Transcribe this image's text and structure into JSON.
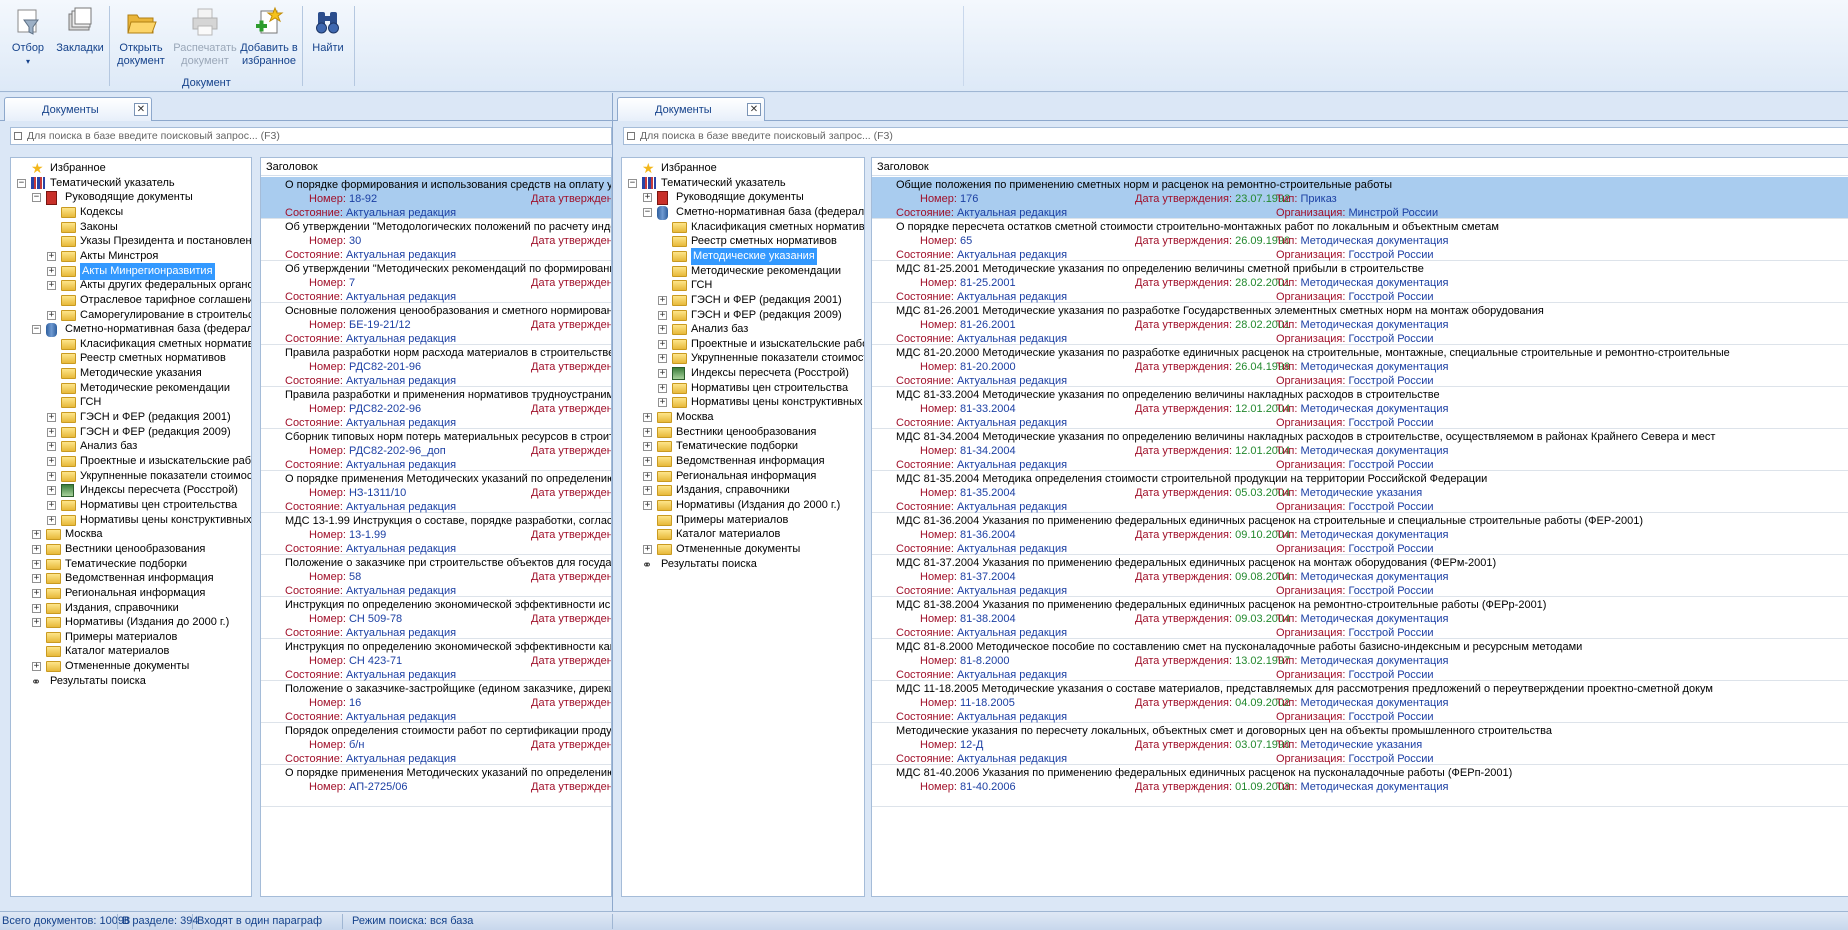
{
  "ribbon": {
    "filter_label": "Отбор",
    "bookmarks_label": "Закладки",
    "open_label_1": "Открыть",
    "open_label_2": "документ",
    "print_label_1": "Распечатать",
    "print_label_2": "документ",
    "fav_label_1": "Добавить в",
    "fav_label_2": "избранное",
    "find_label": "Найти",
    "group_label": "Документ"
  },
  "tab_label": "Документы",
  "tab_close": "✕",
  "search_placeholder": "Для поиска в базе введите поисковый запрос... (F3)",
  "docs_header": "Заголовок",
  "field_labels": {
    "number": "Номер:",
    "date": "Дата утверждения:",
    "state": "Состояние:",
    "type": "Тип:",
    "org": "Организация:"
  },
  "left_tree": [
    {
      "label": "Избранное"
    },
    {
      "label": "Тематический указатель"
    },
    {
      "label": "Руководящие документы"
    },
    {
      "label": "Кодексы"
    },
    {
      "label": "Законы"
    },
    {
      "label": "Указы Президента и постановления Прави"
    },
    {
      "label": "Акты Минстроя"
    },
    {
      "label": "Акты Минрегионразвития"
    },
    {
      "label": "Акты других федеральных органов"
    },
    {
      "label": "Отраслевое тарифное соглашение"
    },
    {
      "label": "Саморегулирование в строительстве"
    },
    {
      "label": "Сметно-нормативная база (федеральная)"
    },
    {
      "label": "Класификация сметных нормативов"
    },
    {
      "label": "Реестр сметных нормативов"
    },
    {
      "label": "Методические указания"
    },
    {
      "label": "Методические рекомендации"
    },
    {
      "label": "ГСН"
    },
    {
      "label": "ГЭСН и ФЕР (редакция 2001)"
    },
    {
      "label": "ГЭСН и ФЕР (редакция 2009)"
    },
    {
      "label": "Анализ баз"
    },
    {
      "label": "Проектные и изыскательские работы"
    },
    {
      "label": "Укрупненные показатели стоимости стро"
    },
    {
      "label": "Индексы пересчета (Росстрой)"
    },
    {
      "label": "Нормативы цен строительства"
    },
    {
      "label": "Нормативы цены конструктивных решени"
    },
    {
      "label": "Москва"
    },
    {
      "label": "Вестники ценообразования"
    },
    {
      "label": "Тематические подборки"
    },
    {
      "label": "Ведомственная информация"
    },
    {
      "label": "Региональная информация"
    },
    {
      "label": "Издания, справочники"
    },
    {
      "label": "Нормативы (Издания до 2000 г.)"
    },
    {
      "label": "Примеры материалов"
    },
    {
      "label": "Каталог материалов"
    },
    {
      "label": "Отмененные документы"
    },
    {
      "label": "Результаты поиска"
    }
  ],
  "right_tree": [
    {
      "label": "Избранное"
    },
    {
      "label": "Тематический указатель"
    },
    {
      "label": "Руководящие документы"
    },
    {
      "label": "Сметно-нормативная база (федеральная)"
    },
    {
      "label": "Класификация сметных нормативов"
    },
    {
      "label": "Реестр сметных нормативов"
    },
    {
      "label": "Методические указания"
    },
    {
      "label": "Методические рекомендации"
    },
    {
      "label": "ГСН"
    },
    {
      "label": "ГЭСН и ФЕР (редакция 2001)"
    },
    {
      "label": "ГЭСН и ФЕР (редакция 2009)"
    },
    {
      "label": "Анализ баз"
    },
    {
      "label": "Проектные и изыскательские работы"
    },
    {
      "label": "Укрупненные показатели стоимости строи"
    },
    {
      "label": "Индексы пересчета (Росстрой)"
    },
    {
      "label": "Нормативы цен строительства"
    },
    {
      "label": "Нормативы цены конструктивных решения"
    },
    {
      "label": "Москва"
    },
    {
      "label": "Вестники ценообразования"
    },
    {
      "label": "Тематические подборки"
    },
    {
      "label": "Ведомственная информация"
    },
    {
      "label": "Региональная информация"
    },
    {
      "label": "Издания, справочники"
    },
    {
      "label": "Нормативы (Издания до 2000 г.)"
    },
    {
      "label": "Примеры материалов"
    },
    {
      "label": "Каталог материалов"
    },
    {
      "label": "Отмененные документы"
    },
    {
      "label": "Результаты поиска"
    }
  ],
  "left_docs": [
    {
      "title": "О порядке формирования и использования средств на оплату услуг регионал",
      "number": "18-92",
      "state": "Актуальная редакция"
    },
    {
      "title": "Об утверждении \"Методологических положений по расчету индексов цен в с",
      "number": "30",
      "state": "Актуальная редакция"
    },
    {
      "title": "Об утверждении \"Методических рекомендаций по формированию цен на жил",
      "number": "7",
      "state": "Актуальная редакция"
    },
    {
      "title": "Основные положения ценообразования и сметного нормирования в строите",
      "number": "БЕ-19-21/12",
      "state": "Актуальная редакция"
    },
    {
      "title": "Правила разработки норм расхода материалов в строительстве",
      "number": "РДС82-201-96",
      "state": "Актуальная редакция"
    },
    {
      "title": "Правила разработки и применения нормативов трудноустранимых потерь и о",
      "number": "РДС82-202-96",
      "state": "Актуальная редакция"
    },
    {
      "title": "Сборник типовых норм потерь материальных ресурсов в строительстве (доп",
      "number": "РДС82-202-96_доп",
      "state": "Актуальная редакция"
    },
    {
      "title": "О порядке применения Методических указаний по определению величины см",
      "number": "НЗ-1311/10",
      "state": "Актуальная редакция"
    },
    {
      "title": "МДС 13-1.99 Инструкция о составе, порядке разработки, согласования и утв",
      "number": "13-1.99",
      "state": "Актуальная редакция"
    },
    {
      "title": "Положение о заказчике при строительстве объектов для государственных н",
      "number": "58",
      "state": "Актуальная редакция"
    },
    {
      "title": "Инструкция по определению экономической эффективности использования в",
      "number": "СН 509-78",
      "state": "Актуальная редакция"
    },
    {
      "title": "Инструкция по определению экономической эффективности кап.вложений в",
      "number": "СН 423-71",
      "state": "Актуальная редакция"
    },
    {
      "title": "Положение о заказчике-застройщике (едином заказчике, дирекции строящег",
      "number": "16",
      "state": "Актуальная редакция"
    },
    {
      "title": "Порядок определения стоимости работ по сертификации продукции и услуг в",
      "number": "б/н",
      "state": "Актуальная редакция"
    },
    {
      "title": "О порядке применения Методических указаний по определению величины с",
      "number": "АП-2725/06",
      "state": ""
    }
  ],
  "right_docs": [
    {
      "title": "Общие положения по применению сметных норм и расценок на ремонтно-строительные работы",
      "number": "176",
      "date": "23.07.1992",
      "type": "Приказ",
      "state": "Актуальная редакция",
      "org": "Минстрой России"
    },
    {
      "title": "О порядке пересчета остатков сметной стоимости строительно-монтажных работ по локальным и объектным сметам",
      "number": "65",
      "date": "26.09.1990",
      "type": "Методическая документация",
      "state": "Актуальная редакция",
      "org": "Госстрой России"
    },
    {
      "title": "МДС 81-25.2001 Методические указания по определению величины сметной прибыли в строительстве",
      "number": "81-25.2001",
      "date": "28.02.2001",
      "type": "Методическая документация",
      "state": "Актуальная редакция",
      "org": "Госстрой России"
    },
    {
      "title": "МДС 81-26.2001 Методические указания по разработке Государственных элементных сметных норм на монтаж оборудования",
      "number": "81-26.2001",
      "date": "28.02.2001",
      "type": "Методическая документация",
      "state": "Актуальная редакция",
      "org": "Госстрой России"
    },
    {
      "title": "МДС 81-20.2000 Методические указания по разработке единичных расценок на строительные, монтажные, специальные строительные и ремонтно-строительные",
      "number": "81-20.2000",
      "date": "26.04.1999",
      "type": "Методическая документация",
      "state": "Актуальная редакция",
      "org": "Госстрой России"
    },
    {
      "title": "МДС 81-33.2004 Методические указания по определению величины накладных расходов в строительстве",
      "number": "81-33.2004",
      "date": "12.01.2004",
      "type": "Методическая документация",
      "state": "Актуальная редакция",
      "org": "Госстрой России"
    },
    {
      "title": "МДС 81-34.2004 Методические указания по определению величины накладных расходов в строительстве, осуществляемом в районах Крайнего Севера и мест",
      "number": "81-34.2004",
      "date": "12.01.2004",
      "type": "Методическая документация",
      "state": "Актуальная редакция",
      "org": "Госстрой России"
    },
    {
      "title": "МДС 81-35.2004 Методика определения стоимости строительной продукции на территории Российской Федерации",
      "number": "81-35.2004",
      "date": "05.03.2004",
      "type": "Методические указания",
      "state": "Актуальная редакция",
      "org": "Госстрой России"
    },
    {
      "title": "МДС 81-36.2004 Указания по применению федеральных единичных расценок на строительные и специальные строительные работы (ФЕР-2001)",
      "number": "81-36.2004",
      "date": "09.10.2004",
      "type": "Методическая документация",
      "state": "Актуальная редакция",
      "org": "Госстрой России"
    },
    {
      "title": "МДС 81-37.2004 Указания по применению федеральных единичных расценок на монтаж оборудования (ФЕРм-2001)",
      "number": "81-37.2004",
      "date": "09.08.2004",
      "type": "Методическая документация",
      "state": "Актуальная редакция",
      "org": "Госстрой России"
    },
    {
      "title": "МДС 81-38.2004 Указания по применению федеральных единичных расценок на ремонтно-строительные работы (ФЕРр-2001)",
      "number": "81-38.2004",
      "date": "09.03.2004",
      "type": "Методическая документация",
      "state": "Актуальная редакция",
      "org": "Госстрой России"
    },
    {
      "title": "МДС 81-8.2000 Методическое пособие по составлению смет на пусконаладочные работы базисно-индексным  и ресурсным методами",
      "number": "81-8.2000",
      "date": "13.02.1997",
      "type": "Методическая документация",
      "state": "Актуальная редакция",
      "org": "Госстрой России"
    },
    {
      "title": "МДС 11-18.2005 Методические указания о составе материалов, представляемых для рассмотрения предложений о переутверждении проектно-сметной докум",
      "number": "11-18.2005",
      "date": "04.09.2002",
      "type": "Методическая документация",
      "state": "Актуальная редакция",
      "org": "Госстрой России"
    },
    {
      "title": "Методические указания по пересчету локальных, объектных смет и договорных цен на объекты промышленного строительства",
      "number": "12-Д",
      "date": "03.07.1990",
      "type": "Методические указания",
      "state": "Актуальная редакция",
      "org": "Госстрой России"
    },
    {
      "title": "МДС 81-40.2006 Указания по применению федеральных единичных расценок на пусконаладочные работы (ФЕРп-2001)",
      "number": "81-40.2006",
      "date": "01.09.2003",
      "type": "Методическая документация",
      "state": "",
      "org": ""
    }
  ],
  "status": {
    "total": "Всего документов: 10098",
    "in_section": "В разделе: 394",
    "paragraph": "Входят в один параграф",
    "mode": "Режим поиска: вся база"
  }
}
